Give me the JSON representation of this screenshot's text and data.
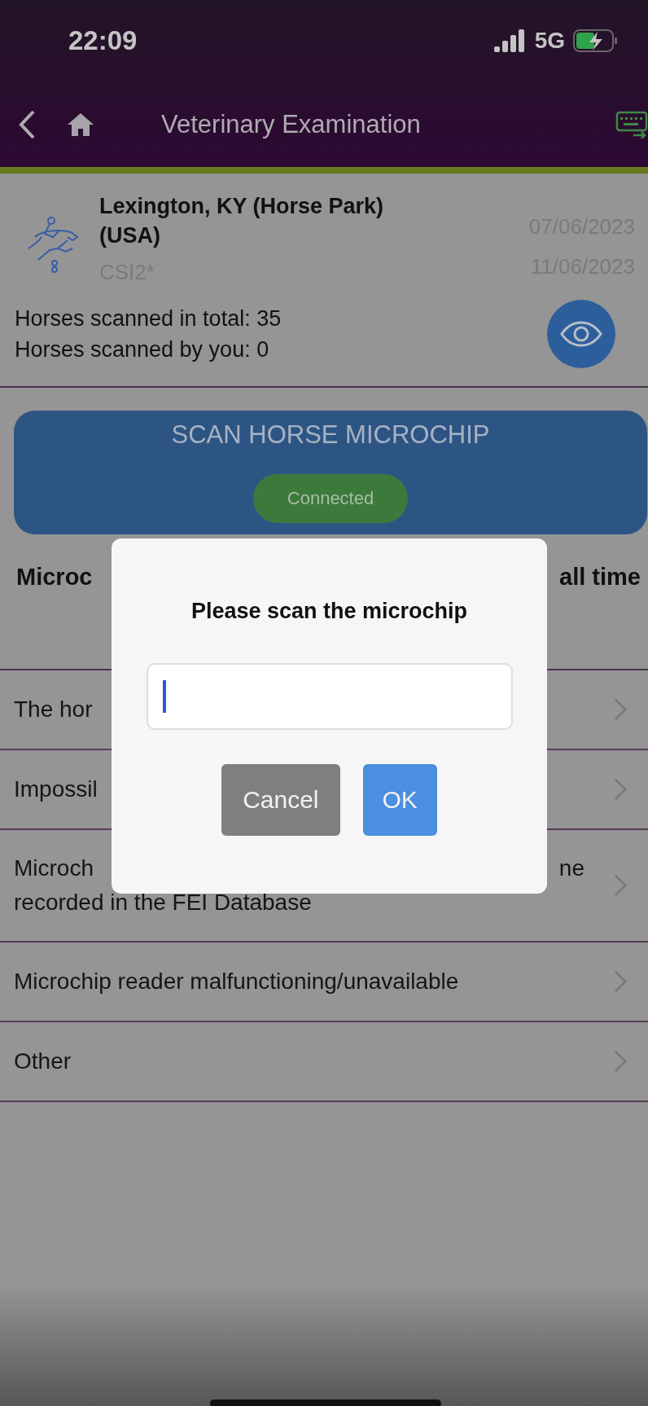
{
  "status_bar": {
    "time": "22:09",
    "network": "5G"
  },
  "nav": {
    "title": "Veterinary Examination"
  },
  "event": {
    "name": "Lexington, KY (Horse Park) (USA)",
    "category": "CSI2*",
    "start_date": "07/06/2023",
    "end_date": "11/06/2023"
  },
  "stats": [
    "Horses scanned in total: 35",
    "Horses scanned by you: 0"
  ],
  "scan": {
    "title": "SCAN HORSE MICROCHIP",
    "status": "Connected"
  },
  "section": {
    "left": "Microc",
    "right": "all time"
  },
  "reasons": [
    {
      "text": "The hor"
    },
    {
      "text": "Impossil"
    },
    {
      "text": "Microch",
      "text_right": "ne",
      "line_2": "recorded in the FEI Database"
    },
    {
      "text": "Microchip reader malfunctioning/unavailable"
    },
    {
      "text": "Other"
    }
  ],
  "dialog": {
    "title": "Please scan the microchip",
    "input": {
      "focused": true
    },
    "buttons": [
      {
        "label": "Cancel",
        "kind": "secondary"
      },
      {
        "label": "OK",
        "kind": "primary"
      }
    ]
  }
}
